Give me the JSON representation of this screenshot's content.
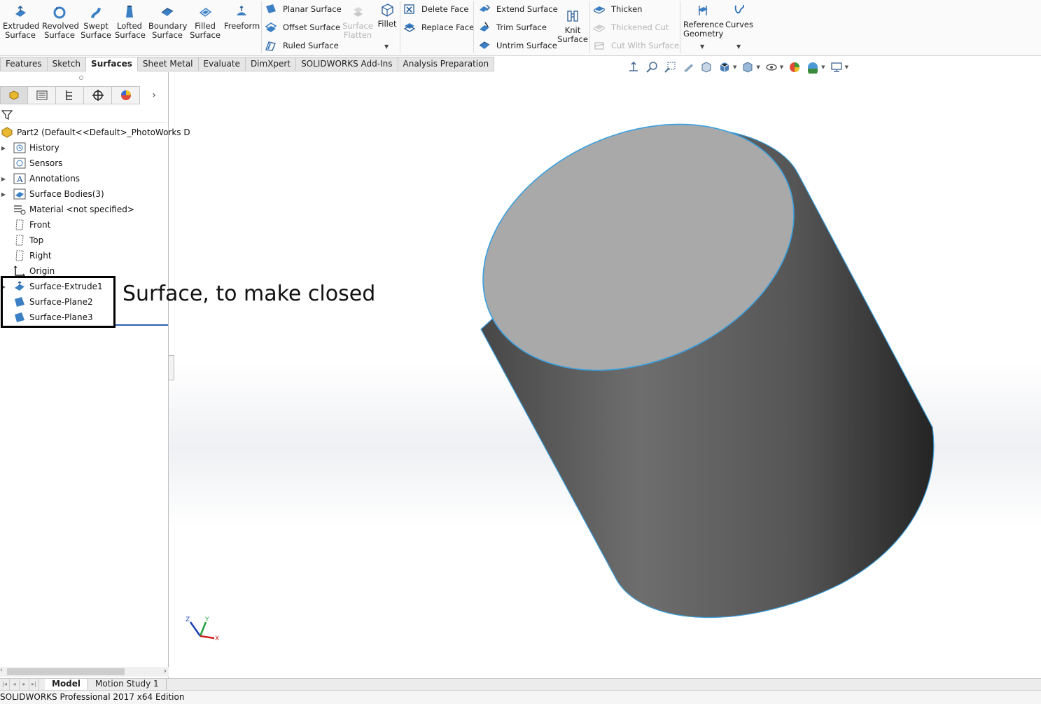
{
  "ribbon": {
    "big_buttons": [
      {
        "label": "Extruded\nSurface",
        "icon": "extruded-surface-icon"
      },
      {
        "label": "Revolved\nSurface",
        "icon": "revolved-surface-icon"
      },
      {
        "label": "Swept\nSurface",
        "icon": "swept-surface-icon"
      },
      {
        "label": "Lofted\nSurface",
        "icon": "lofted-surface-icon"
      },
      {
        "label": "Boundary\nSurface",
        "icon": "boundary-surface-icon"
      },
      {
        "label": "Filled\nSurface",
        "icon": "filled-surface-icon"
      },
      {
        "label": "Freeform",
        "icon": "freeform-icon"
      }
    ],
    "planar_surface": "Planar Surface",
    "offset_surface": "Offset Surface",
    "ruled_surface": "Ruled Surface",
    "surface_flatten": "Surface\nFlatten",
    "fillet": "Fillet",
    "delete_face": "Delete Face",
    "replace_face": "Replace Face",
    "extend_surface": "Extend Surface",
    "trim_surface": "Trim Surface",
    "untrim_surface": "Untrim Surface",
    "knit_surface": "Knit\nSurface",
    "thicken": "Thicken",
    "thickened_cut": "Thickened Cut",
    "cut_with_surface": "Cut With Surface",
    "reference_geometry": "Reference\nGeometry",
    "curves": "Curves"
  },
  "tabs": [
    "Features",
    "Sketch",
    "Surfaces",
    "Sheet Metal",
    "Evaluate",
    "DimXpert",
    "SOLIDWORKS Add-Ins",
    "Analysis Preparation"
  ],
  "active_tab": "Surfaces",
  "tree": {
    "root": "Part2  (Default<<Default>_PhotoWorks D",
    "items": [
      {
        "label": "History",
        "icon": "history-icon",
        "expandable": true
      },
      {
        "label": "Sensors",
        "icon": "sensors-icon",
        "expandable": false
      },
      {
        "label": "Annotations",
        "icon": "annotations-icon",
        "expandable": true
      },
      {
        "label": "Surface Bodies(3)",
        "icon": "surface-bodies-icon",
        "expandable": true
      },
      {
        "label": "Material <not specified>",
        "icon": "material-icon",
        "expandable": false
      },
      {
        "label": "Front",
        "icon": "plane-icon",
        "expandable": false
      },
      {
        "label": "Top",
        "icon": "plane-icon",
        "expandable": false
      },
      {
        "label": "Right",
        "icon": "plane-icon",
        "expandable": false
      },
      {
        "label": "Origin",
        "icon": "origin-icon",
        "expandable": false
      },
      {
        "label": "Surface-Extrude1",
        "icon": "surface-extrude-icon",
        "expandable": true
      },
      {
        "label": "Surface-Plane2",
        "icon": "surface-plane-icon",
        "expandable": false
      },
      {
        "label": "Surface-Plane3",
        "icon": "surface-plane-icon",
        "expandable": false
      }
    ]
  },
  "callout": "Surface, to make closed",
  "bottom_tabs": [
    "Model",
    "Motion Study 1"
  ],
  "status": "SOLIDWORKS Professional 2017 x64 Edition",
  "colors": {
    "accent_blue": "#2b6fb6",
    "edge_highlight": "#3aa0e0",
    "cylinder_top": "#a8a8a8"
  }
}
